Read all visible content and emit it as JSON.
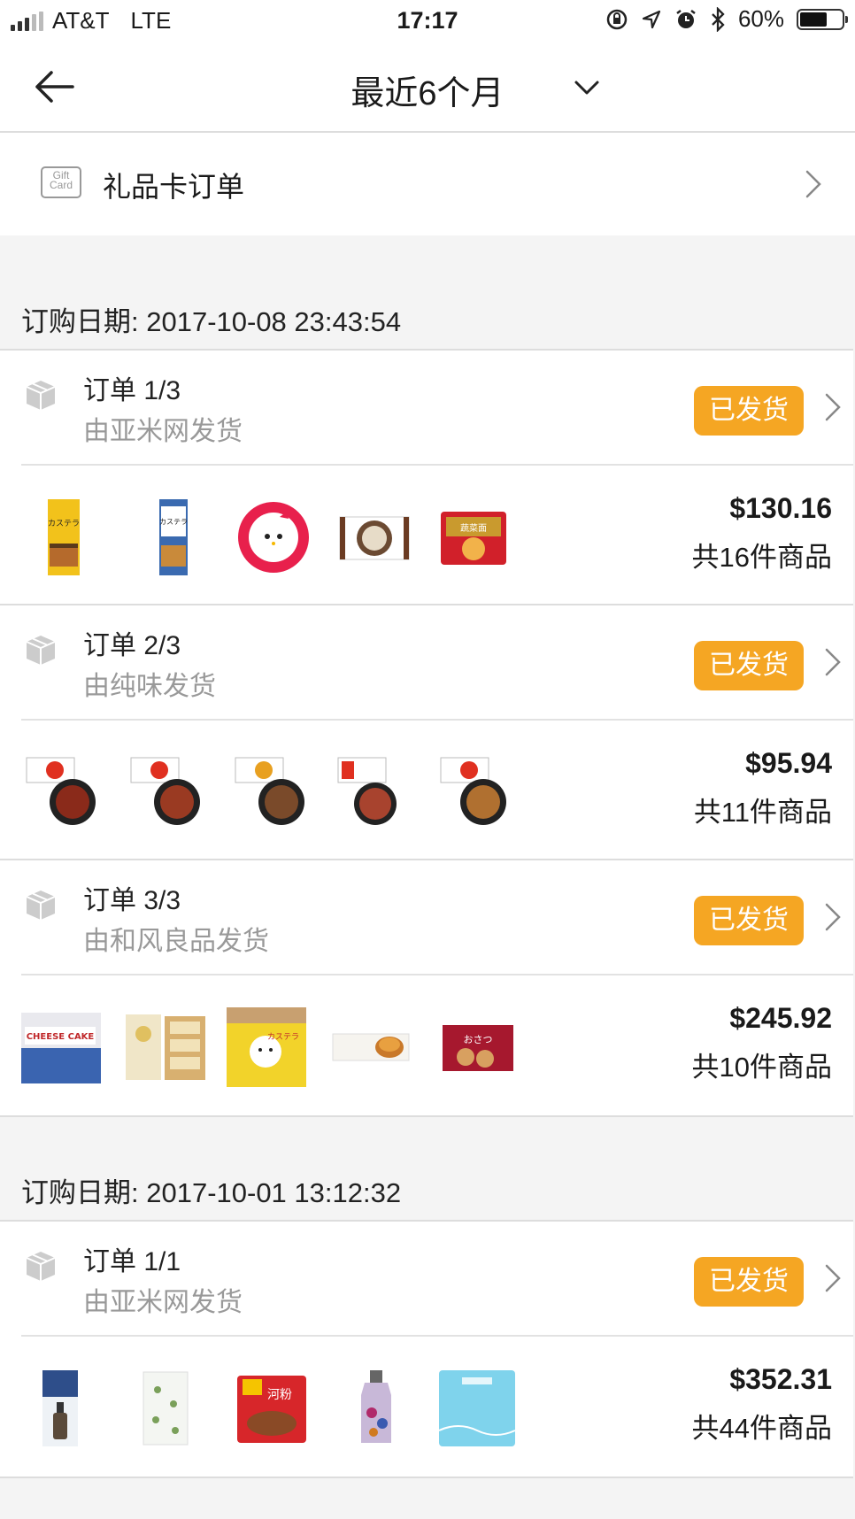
{
  "status": {
    "carrier": "AT&T",
    "network": "LTE",
    "time": "17:17",
    "battery": "60%"
  },
  "nav": {
    "title": "最近6个月"
  },
  "gift": {
    "icon_text_1": "Gift",
    "icon_text_2": "Card",
    "label": "礼品卡订单"
  },
  "groups": [
    {
      "date": "订购日期: 2017-10-08 23:43:54"
    },
    {
      "date": "订购日期: 2017-10-01 13:12:32"
    }
  ],
  "orders": [
    {
      "number": "订单 1/3",
      "seller": "由亚米网发货",
      "status": "已发货",
      "price": "$130.16",
      "count": "共16件商品"
    },
    {
      "number": "订单 2/3",
      "seller": "由纯味发货",
      "status": "已发货",
      "price": "$95.94",
      "count": "共11件商品"
    },
    {
      "number": "订单 3/3",
      "seller": "由和风良品发货",
      "status": "已发货",
      "price": "$245.92",
      "count": "共10件商品"
    },
    {
      "number": "订单 1/1",
      "seller": "由亚米网发货",
      "status": "已发货",
      "price": "$352.31",
      "count": "共44件商品"
    }
  ],
  "thumb_labels": {
    "o1": [
      "カステラ",
      "カステラ",
      "",
      "",
      "蔬菜面"
    ],
    "o2": [
      "",
      "",
      "",
      "",
      ""
    ],
    "o3": [
      "CHEESE CAKE",
      "",
      "カステラ",
      "",
      "おさつ"
    ],
    "o4": [
      "",
      "",
      "河粉",
      "",
      ""
    ]
  },
  "colors": {
    "badge": "#f5a623",
    "muted": "#999999",
    "background": "#f4f4f4"
  }
}
